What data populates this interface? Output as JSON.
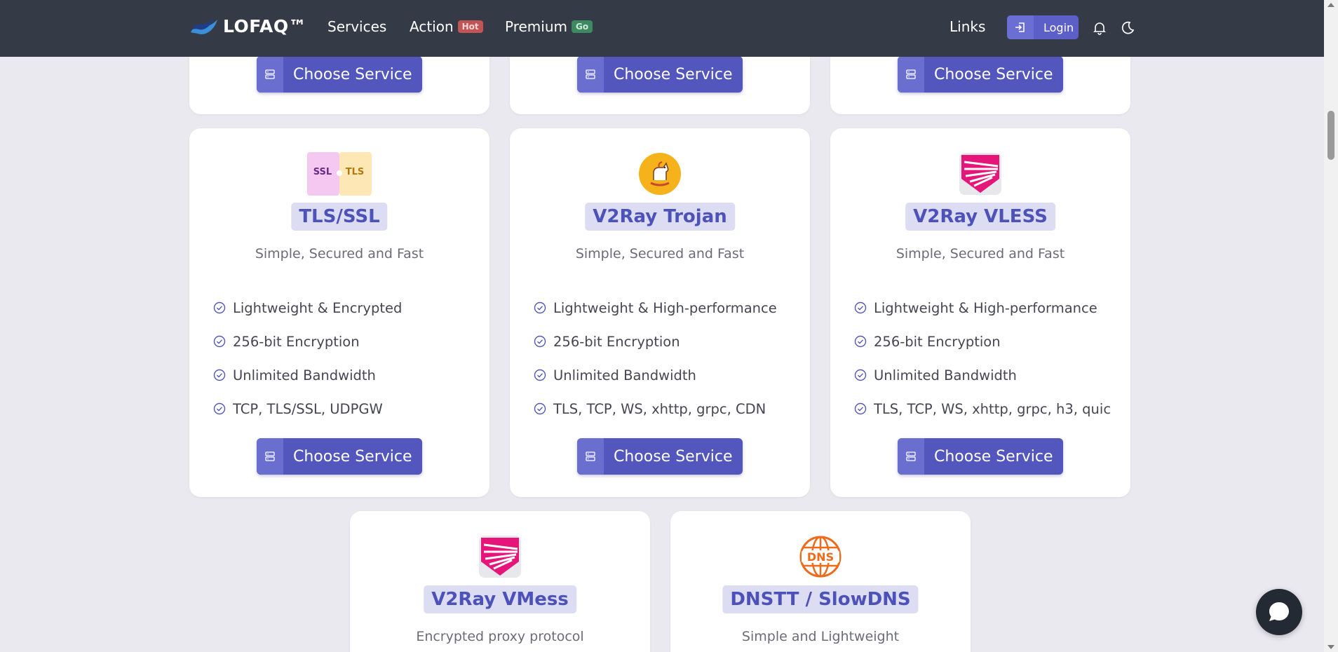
{
  "nav": {
    "brand": "LOFAQ™",
    "items": [
      {
        "label": "Services",
        "badge": ""
      },
      {
        "label": "Action",
        "badge": "Hot"
      },
      {
        "label": "Premium",
        "badge": "Go"
      }
    ],
    "links_label": "Links",
    "login_label": "Login",
    "icons": [
      "bell-icon",
      "moon-icon"
    ]
  },
  "colors": {
    "navbar": "#343a46",
    "accent": "#5256bd",
    "title_pill_bg": "#dcdcf3",
    "title_text": "#4d52b8",
    "badge_hot": "#c15454",
    "badge_go": "#3e8a60"
  },
  "top_row_buttons": [
    "Choose Service",
    "Choose Service",
    "Choose Service"
  ],
  "cards": [
    {
      "title": "TLS/SSL",
      "logo": "ssl-tls-logo",
      "logo_text_left": "SSL",
      "logo_text_right": "TLS",
      "subtitle": "Simple, Secured and Fast",
      "features": [
        "Lightweight & Encrypted",
        "256-bit Encryption",
        "Unlimited Bandwidth",
        "TCP, TLS/SSL, UDPGW"
      ],
      "button": "Choose Service"
    },
    {
      "title": "V2Ray Trojan",
      "logo": "trojan-horse-logo",
      "subtitle": "Simple, Secured and Fast",
      "features": [
        "Lightweight & High-performance",
        "256-bit Encryption",
        "Unlimited Bandwidth",
        "TLS, TCP, WS, xhttp, grpc, CDN"
      ],
      "button": "Choose Service"
    },
    {
      "title": "V2Ray VLESS",
      "logo": "v2ray-logo",
      "subtitle": "Simple, Secured and Fast",
      "features": [
        "Lightweight & High-performance",
        "256-bit Encryption",
        "Unlimited Bandwidth",
        "TLS, TCP, WS, xhttp, grpc, h3, quic"
      ],
      "button": "Choose Service"
    },
    {
      "title": "V2Ray VMess",
      "logo": "v2ray-logo",
      "subtitle": "Encrypted proxy protocol"
    },
    {
      "title": "DNSTT / SlowDNS",
      "logo": "dns-globe-logo",
      "logo_text": "DNS",
      "subtitle": "Simple and Lightweight"
    }
  ]
}
